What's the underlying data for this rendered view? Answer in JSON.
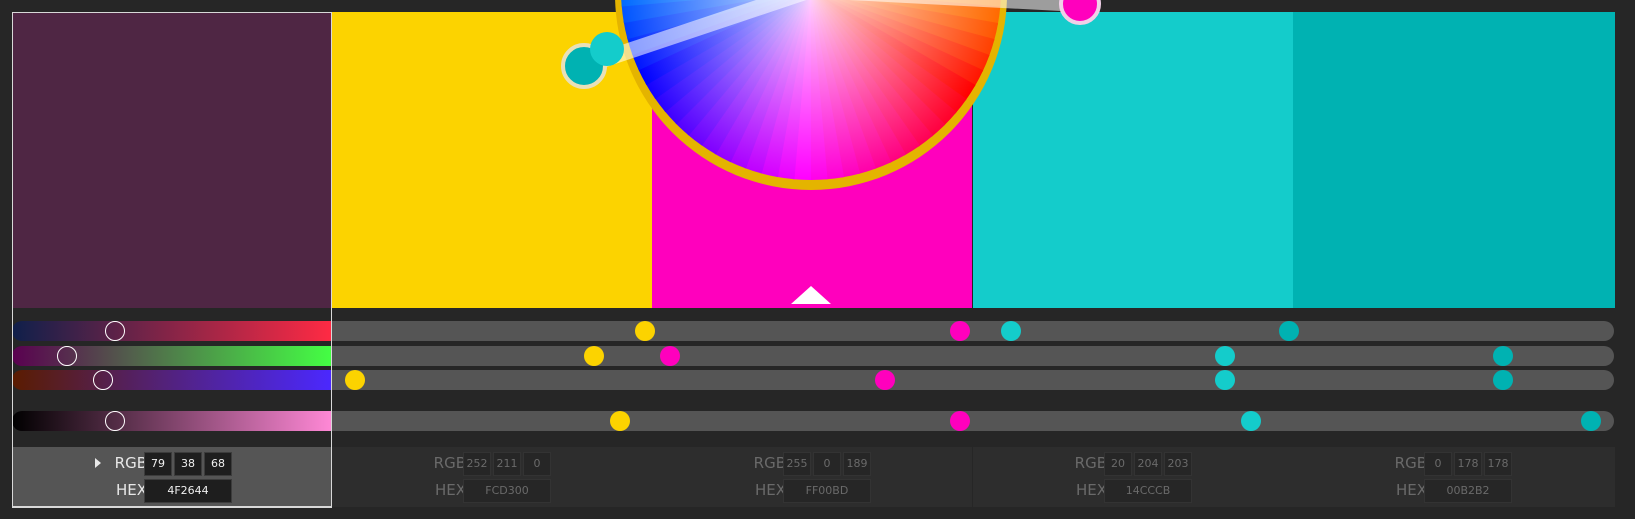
{
  "colors": [
    {
      "name": "plum",
      "hex": "4F2644",
      "rgb": [
        "79",
        "38",
        "68"
      ],
      "css": "#4f2644",
      "selected": true
    },
    {
      "name": "yellow",
      "hex": "FCD300",
      "rgb": [
        "252",
        "211",
        "0"
      ],
      "css": "#fcd300",
      "selected": false
    },
    {
      "name": "magenta",
      "hex": "FF00BD",
      "rgb": [
        "255",
        "0",
        "189"
      ],
      "css": "#ff00bd",
      "selected": false
    },
    {
      "name": "cyan",
      "hex": "14CCCB",
      "rgb": [
        "20",
        "204",
        "203"
      ],
      "css": "#14cccb",
      "selected": false
    },
    {
      "name": "teal",
      "hex": "00B2B2",
      "rgb": [
        "0",
        "178",
        "178"
      ],
      "css": "#00b2b2",
      "selected": false
    }
  ],
  "labels": {
    "rgb": "RGB",
    "hex": "HEX"
  },
  "slider_rows": [
    {
      "channel": "red",
      "gradient": [
        "#0f1f4a",
        "#ff2a44"
      ],
      "selected_level": 0.31,
      "others": [
        {
          "c": 1,
          "level": 0.24
        },
        {
          "c": 2,
          "level": 0.49
        },
        {
          "c": 3,
          "level": 0.53
        },
        {
          "c": 4,
          "level": 0.75
        }
      ]
    },
    {
      "channel": "green",
      "gradient": [
        "#5a0050",
        "#44ff44"
      ],
      "selected_level": 0.15,
      "others": [
        {
          "c": 1,
          "level": 0.2
        },
        {
          "c": 2,
          "level": 0.26
        },
        {
          "c": 3,
          "level": 0.7
        },
        {
          "c": 4,
          "level": 0.92
        }
      ]
    },
    {
      "channel": "blue",
      "gradient": [
        "#5a1c00",
        "#4b28ff"
      ],
      "selected_level": 0.27,
      "others": [
        {
          "c": 1,
          "level": 0.01
        },
        {
          "c": 2,
          "level": 0.43
        },
        {
          "c": 3,
          "level": 0.7
        },
        {
          "c": 4,
          "level": 0.92
        }
      ]
    },
    {
      "channel": "lightness",
      "gradient": [
        "#000000",
        "#ff88d6"
      ],
      "selected_level": 0.31,
      "others": [
        {
          "c": 1,
          "level": 0.22
        },
        {
          "c": 2,
          "level": 0.49
        },
        {
          "c": 3,
          "level": 0.72
        },
        {
          "c": 4,
          "level": 0.99
        }
      ]
    }
  ]
}
